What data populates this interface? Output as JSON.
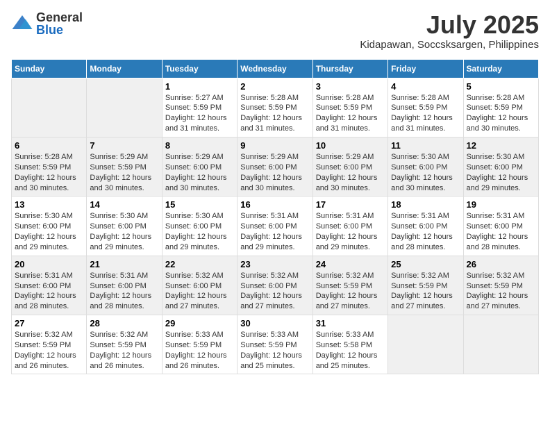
{
  "header": {
    "logo_general": "General",
    "logo_blue": "Blue",
    "month_year": "July 2025",
    "location": "Kidapawan, Soccsksargen, Philippines"
  },
  "days_of_week": [
    "Sunday",
    "Monday",
    "Tuesday",
    "Wednesday",
    "Thursday",
    "Friday",
    "Saturday"
  ],
  "weeks": [
    [
      {
        "day": "",
        "content": ""
      },
      {
        "day": "",
        "content": ""
      },
      {
        "day": "1",
        "sunrise": "Sunrise: 5:27 AM",
        "sunset": "Sunset: 5:59 PM",
        "daylight": "Daylight: 12 hours and 31 minutes."
      },
      {
        "day": "2",
        "sunrise": "Sunrise: 5:28 AM",
        "sunset": "Sunset: 5:59 PM",
        "daylight": "Daylight: 12 hours and 31 minutes."
      },
      {
        "day": "3",
        "sunrise": "Sunrise: 5:28 AM",
        "sunset": "Sunset: 5:59 PM",
        "daylight": "Daylight: 12 hours and 31 minutes."
      },
      {
        "day": "4",
        "sunrise": "Sunrise: 5:28 AM",
        "sunset": "Sunset: 5:59 PM",
        "daylight": "Daylight: 12 hours and 31 minutes."
      },
      {
        "day": "5",
        "sunrise": "Sunrise: 5:28 AM",
        "sunset": "Sunset: 5:59 PM",
        "daylight": "Daylight: 12 hours and 30 minutes."
      }
    ],
    [
      {
        "day": "6",
        "sunrise": "Sunrise: 5:28 AM",
        "sunset": "Sunset: 5:59 PM",
        "daylight": "Daylight: 12 hours and 30 minutes."
      },
      {
        "day": "7",
        "sunrise": "Sunrise: 5:29 AM",
        "sunset": "Sunset: 5:59 PM",
        "daylight": "Daylight: 12 hours and 30 minutes."
      },
      {
        "day": "8",
        "sunrise": "Sunrise: 5:29 AM",
        "sunset": "Sunset: 6:00 PM",
        "daylight": "Daylight: 12 hours and 30 minutes."
      },
      {
        "day": "9",
        "sunrise": "Sunrise: 5:29 AM",
        "sunset": "Sunset: 6:00 PM",
        "daylight": "Daylight: 12 hours and 30 minutes."
      },
      {
        "day": "10",
        "sunrise": "Sunrise: 5:29 AM",
        "sunset": "Sunset: 6:00 PM",
        "daylight": "Daylight: 12 hours and 30 minutes."
      },
      {
        "day": "11",
        "sunrise": "Sunrise: 5:30 AM",
        "sunset": "Sunset: 6:00 PM",
        "daylight": "Daylight: 12 hours and 30 minutes."
      },
      {
        "day": "12",
        "sunrise": "Sunrise: 5:30 AM",
        "sunset": "Sunset: 6:00 PM",
        "daylight": "Daylight: 12 hours and 29 minutes."
      }
    ],
    [
      {
        "day": "13",
        "sunrise": "Sunrise: 5:30 AM",
        "sunset": "Sunset: 6:00 PM",
        "daylight": "Daylight: 12 hours and 29 minutes."
      },
      {
        "day": "14",
        "sunrise": "Sunrise: 5:30 AM",
        "sunset": "Sunset: 6:00 PM",
        "daylight": "Daylight: 12 hours and 29 minutes."
      },
      {
        "day": "15",
        "sunrise": "Sunrise: 5:30 AM",
        "sunset": "Sunset: 6:00 PM",
        "daylight": "Daylight: 12 hours and 29 minutes."
      },
      {
        "day": "16",
        "sunrise": "Sunrise: 5:31 AM",
        "sunset": "Sunset: 6:00 PM",
        "daylight": "Daylight: 12 hours and 29 minutes."
      },
      {
        "day": "17",
        "sunrise": "Sunrise: 5:31 AM",
        "sunset": "Sunset: 6:00 PM",
        "daylight": "Daylight: 12 hours and 29 minutes."
      },
      {
        "day": "18",
        "sunrise": "Sunrise: 5:31 AM",
        "sunset": "Sunset: 6:00 PM",
        "daylight": "Daylight: 12 hours and 28 minutes."
      },
      {
        "day": "19",
        "sunrise": "Sunrise: 5:31 AM",
        "sunset": "Sunset: 6:00 PM",
        "daylight": "Daylight: 12 hours and 28 minutes."
      }
    ],
    [
      {
        "day": "20",
        "sunrise": "Sunrise: 5:31 AM",
        "sunset": "Sunset: 6:00 PM",
        "daylight": "Daylight: 12 hours and 28 minutes."
      },
      {
        "day": "21",
        "sunrise": "Sunrise: 5:31 AM",
        "sunset": "Sunset: 6:00 PM",
        "daylight": "Daylight: 12 hours and 28 minutes."
      },
      {
        "day": "22",
        "sunrise": "Sunrise: 5:32 AM",
        "sunset": "Sunset: 6:00 PM",
        "daylight": "Daylight: 12 hours and 27 minutes."
      },
      {
        "day": "23",
        "sunrise": "Sunrise: 5:32 AM",
        "sunset": "Sunset: 6:00 PM",
        "daylight": "Daylight: 12 hours and 27 minutes."
      },
      {
        "day": "24",
        "sunrise": "Sunrise: 5:32 AM",
        "sunset": "Sunset: 5:59 PM",
        "daylight": "Daylight: 12 hours and 27 minutes."
      },
      {
        "day": "25",
        "sunrise": "Sunrise: 5:32 AM",
        "sunset": "Sunset: 5:59 PM",
        "daylight": "Daylight: 12 hours and 27 minutes."
      },
      {
        "day": "26",
        "sunrise": "Sunrise: 5:32 AM",
        "sunset": "Sunset: 5:59 PM",
        "daylight": "Daylight: 12 hours and 27 minutes."
      }
    ],
    [
      {
        "day": "27",
        "sunrise": "Sunrise: 5:32 AM",
        "sunset": "Sunset: 5:59 PM",
        "daylight": "Daylight: 12 hours and 26 minutes."
      },
      {
        "day": "28",
        "sunrise": "Sunrise: 5:32 AM",
        "sunset": "Sunset: 5:59 PM",
        "daylight": "Daylight: 12 hours and 26 minutes."
      },
      {
        "day": "29",
        "sunrise": "Sunrise: 5:33 AM",
        "sunset": "Sunset: 5:59 PM",
        "daylight": "Daylight: 12 hours and 26 minutes."
      },
      {
        "day": "30",
        "sunrise": "Sunrise: 5:33 AM",
        "sunset": "Sunset: 5:59 PM",
        "daylight": "Daylight: 12 hours and 25 minutes."
      },
      {
        "day": "31",
        "sunrise": "Sunrise: 5:33 AM",
        "sunset": "Sunset: 5:58 PM",
        "daylight": "Daylight: 12 hours and 25 minutes."
      },
      {
        "day": "",
        "content": ""
      },
      {
        "day": "",
        "content": ""
      }
    ]
  ]
}
